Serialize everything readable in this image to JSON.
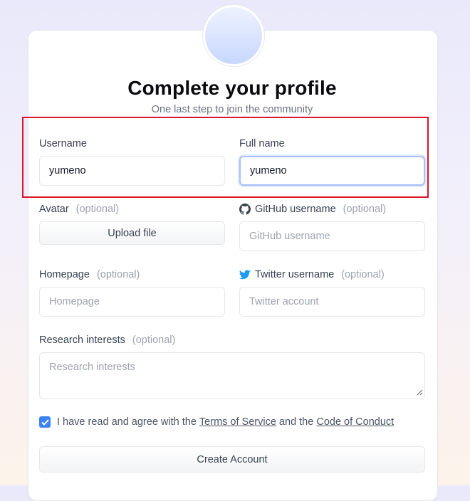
{
  "header": {
    "title": "Complete your profile",
    "subtitle": "One last step to join the community"
  },
  "fields": {
    "username": {
      "label": "Username",
      "value": "yumeno"
    },
    "fullname": {
      "label": "Full name",
      "value": "yumeno"
    },
    "avatar": {
      "label": "Avatar",
      "optional": "(optional)",
      "button": "Upload file"
    },
    "github": {
      "label": "GitHub username",
      "optional": "(optional)",
      "placeholder": "GitHub username",
      "icon": "github-icon"
    },
    "homepage": {
      "label": "Homepage",
      "optional": "(optional)",
      "placeholder": "Homepage"
    },
    "twitter": {
      "label": "Twitter username",
      "optional": "(optional)",
      "placeholder": "Twitter account",
      "icon": "twitter-icon"
    },
    "research": {
      "label": "Research interests",
      "optional": "(optional)",
      "placeholder": "Research interests"
    }
  },
  "terms": {
    "checked": true,
    "prefix": "I have read and agree with the ",
    "tos_link": "Terms of Service",
    "middle": " and the ",
    "coc_link": "Code of Conduct"
  },
  "submit_label": "Create Account",
  "colors": {
    "accent": "#3b82f6",
    "highlight": "#d9162a",
    "twitter": "#1d9bf0"
  }
}
